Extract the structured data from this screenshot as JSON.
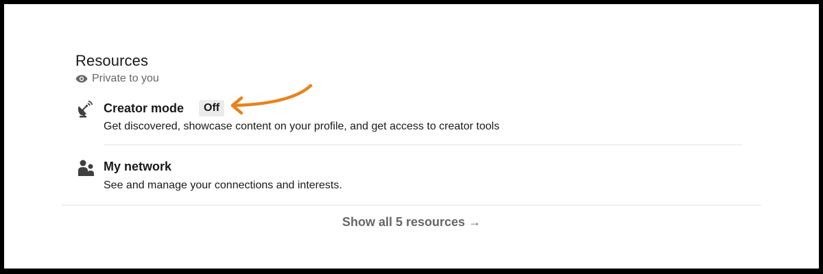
{
  "resources": {
    "title": "Resources",
    "privacy_label": "Private to you",
    "items": [
      {
        "title": "Creator mode",
        "badge": "Off",
        "description": "Get discovered, showcase content on your profile, and get access to creator tools",
        "icon": "satellite-dish-icon"
      },
      {
        "title": "My network",
        "description": "See and manage your connections and interests.",
        "icon": "people-icon"
      }
    ],
    "show_all_label": "Show all 5 resources →"
  },
  "colors": {
    "annotation_arrow": "#e8831d",
    "muted_text": "#666666",
    "badge_bg": "#ebebeb",
    "divider": "#e3e3e3"
  }
}
